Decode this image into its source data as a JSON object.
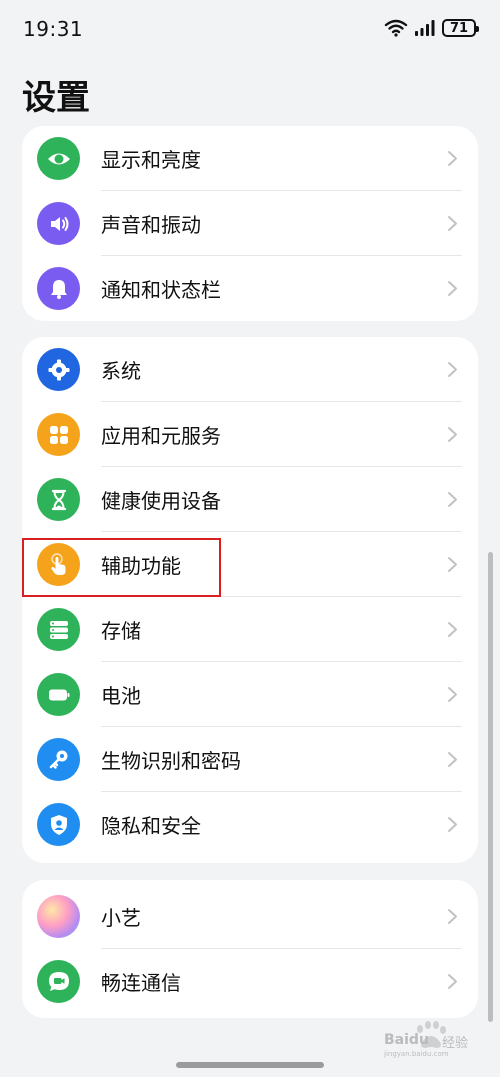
{
  "status_bar": {
    "time": "19:31",
    "battery": "71"
  },
  "page_title": "设置",
  "groups": [
    [
      {
        "label": "显示和亮度",
        "icon": "eye-icon",
        "color": "#2fb35a"
      },
      {
        "label": "声音和振动",
        "icon": "speaker-icon",
        "color": "#7b5cf0"
      },
      {
        "label": "通知和状态栏",
        "icon": "bell-icon",
        "color": "#7b5cf0"
      }
    ],
    [
      {
        "label": "系统",
        "icon": "gear-icon",
        "color": "#1f66e0"
      },
      {
        "label": "应用和元服务",
        "icon": "apps-grid-icon",
        "color": "#f5a31a"
      },
      {
        "label": "健康使用设备",
        "icon": "hourglass-icon",
        "color": "#2fb35a"
      },
      {
        "label": "辅助功能",
        "icon": "hand-pointer-icon",
        "color": "#f5a31a"
      },
      {
        "label": "存储",
        "icon": "storage-icon",
        "color": "#2fb35a"
      },
      {
        "label": "电池",
        "icon": "battery-icon",
        "color": "#2fb35a"
      },
      {
        "label": "生物识别和密码",
        "icon": "key-icon",
        "color": "#1f8ef0"
      },
      {
        "label": "隐私和安全",
        "icon": "shield-user-icon",
        "color": "#1f8ef0"
      }
    ],
    [
      {
        "label": "小艺",
        "icon": "xiaoyi-orb-icon",
        "color": "#e883c9"
      },
      {
        "label": "畅连通信",
        "icon": "video-call-icon",
        "color": "#2fb35a"
      }
    ]
  ],
  "watermark": {
    "text1": "Baidu",
    "text2": "经验",
    "text3": "jingyan.baidu.com"
  }
}
